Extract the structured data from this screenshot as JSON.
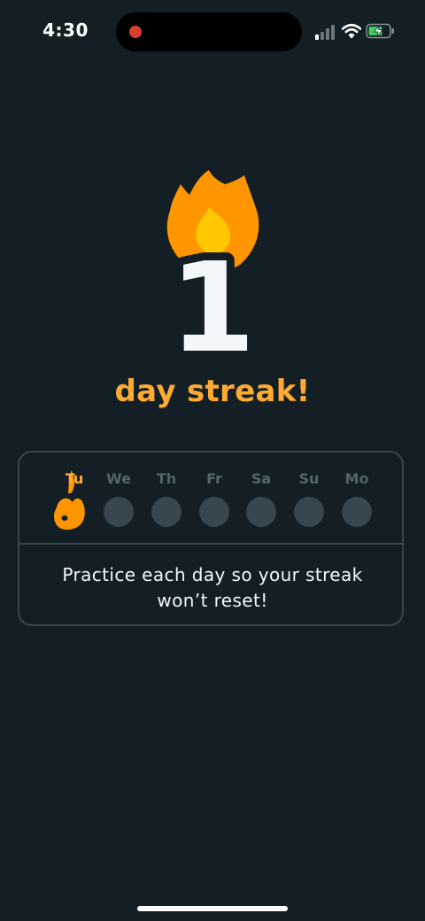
{
  "status_bar": {
    "time": "4:30",
    "recording_indicator_color": "#d6412f",
    "icons": [
      "cellular-signal-icon",
      "wifi-icon",
      "battery-charging-icon"
    ]
  },
  "hero": {
    "streak_count": "1",
    "streak_label": "day streak!",
    "icon": "flame-icon"
  },
  "calendar": {
    "days": [
      {
        "label": "Tu",
        "completed": true
      },
      {
        "label": "We",
        "completed": false
      },
      {
        "label": "Th",
        "completed": false
      },
      {
        "label": "Fr",
        "completed": false
      },
      {
        "label": "Sa",
        "completed": false
      },
      {
        "label": "Su",
        "completed": false
      },
      {
        "label": "Mo",
        "completed": false
      }
    ],
    "message": "Practice each day so your streak won’t reset!"
  },
  "colors": {
    "background": "#131f24",
    "accent_orange": "#ffab33",
    "flame_outer": "#ff9600",
    "flame_inner": "#ffc800",
    "card_border": "#37464f",
    "inactive_day": "#37464f",
    "inactive_label": "#52656d"
  }
}
